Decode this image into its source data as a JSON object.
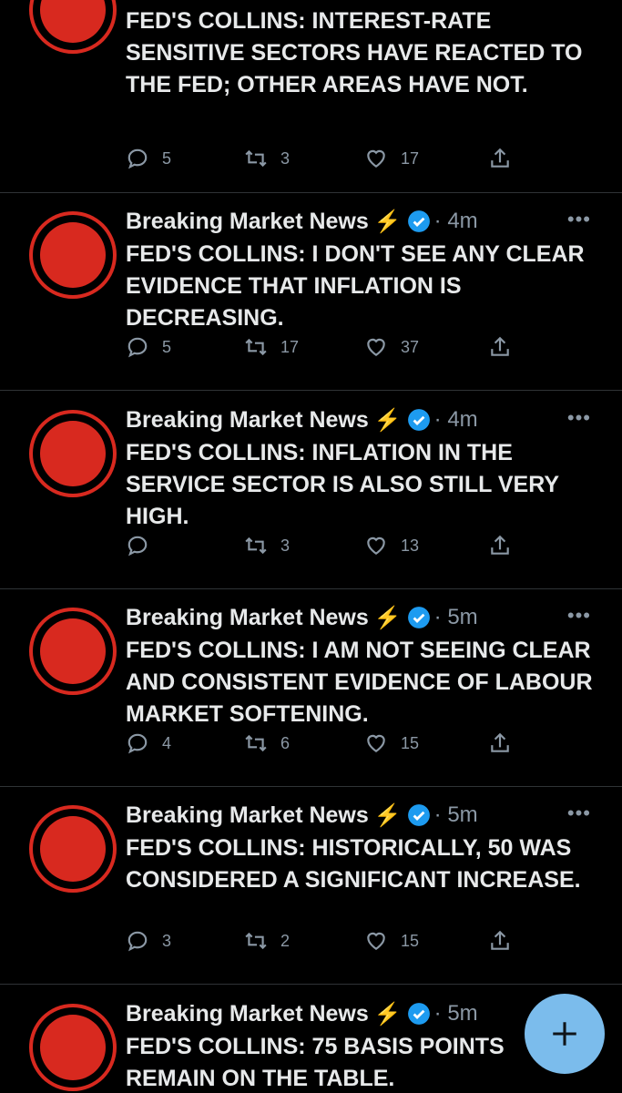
{
  "tweets": [
    {
      "name": "",
      "bolt": "",
      "time": "",
      "text": "FED'S COLLINS: INTEREST-RATE SENSITIVE SECTORS HAVE REACTED TO THE FED; OTHER AREAS HAVE NOT.",
      "replies": "5",
      "retweets": "3",
      "likes": "17"
    },
    {
      "name": "Breaking Market News",
      "bolt": "⚡",
      "time": "· 4m",
      "text": "FED'S COLLINS: I DON'T SEE ANY CLEAR EVIDENCE THAT INFLATION IS DECREASING.",
      "replies": "5",
      "retweets": "17",
      "likes": "37"
    },
    {
      "name": "Breaking Market News",
      "bolt": "⚡",
      "time": "· 4m",
      "text": "FED'S COLLINS: INFLATION IN THE SERVICE SECTOR IS ALSO STILL VERY HIGH.",
      "replies": "",
      "retweets": "3",
      "likes": "13"
    },
    {
      "name": "Breaking Market News",
      "bolt": "⚡",
      "time": "· 5m",
      "text": "FED'S COLLINS: I AM NOT SEEING CLEAR AND CONSISTENT EVIDENCE OF LABOUR MARKET SOFTENING.",
      "replies": "4",
      "retweets": "6",
      "likes": "15"
    },
    {
      "name": "Breaking Market News",
      "bolt": "⚡",
      "time": "· 5m",
      "text": "FED'S COLLINS: HISTORICALLY, 50 WAS CONSIDERED A SIGNIFICANT INCREASE.",
      "replies": "3",
      "retweets": "2",
      "likes": "15"
    },
    {
      "name": "Breaking Market News",
      "bolt": "⚡",
      "time": "· 5m",
      "text": "FED'S COLLINS: 75 BASIS POINTS REMAIN ON THE TABLE.",
      "replies": "",
      "retweets": "",
      "likes": ""
    }
  ],
  "more_label": "•••",
  "colors": {
    "accent": "#7bbcec",
    "avatar_red": "#d8291f",
    "verified": "#1d9bf0",
    "bolt": "#f4b400"
  },
  "icons": {
    "reply": "reply-icon",
    "retweet": "retweet-icon",
    "like": "heart-icon",
    "share": "share-icon",
    "compose": "plus-icon",
    "verified": "verified-badge-icon"
  }
}
